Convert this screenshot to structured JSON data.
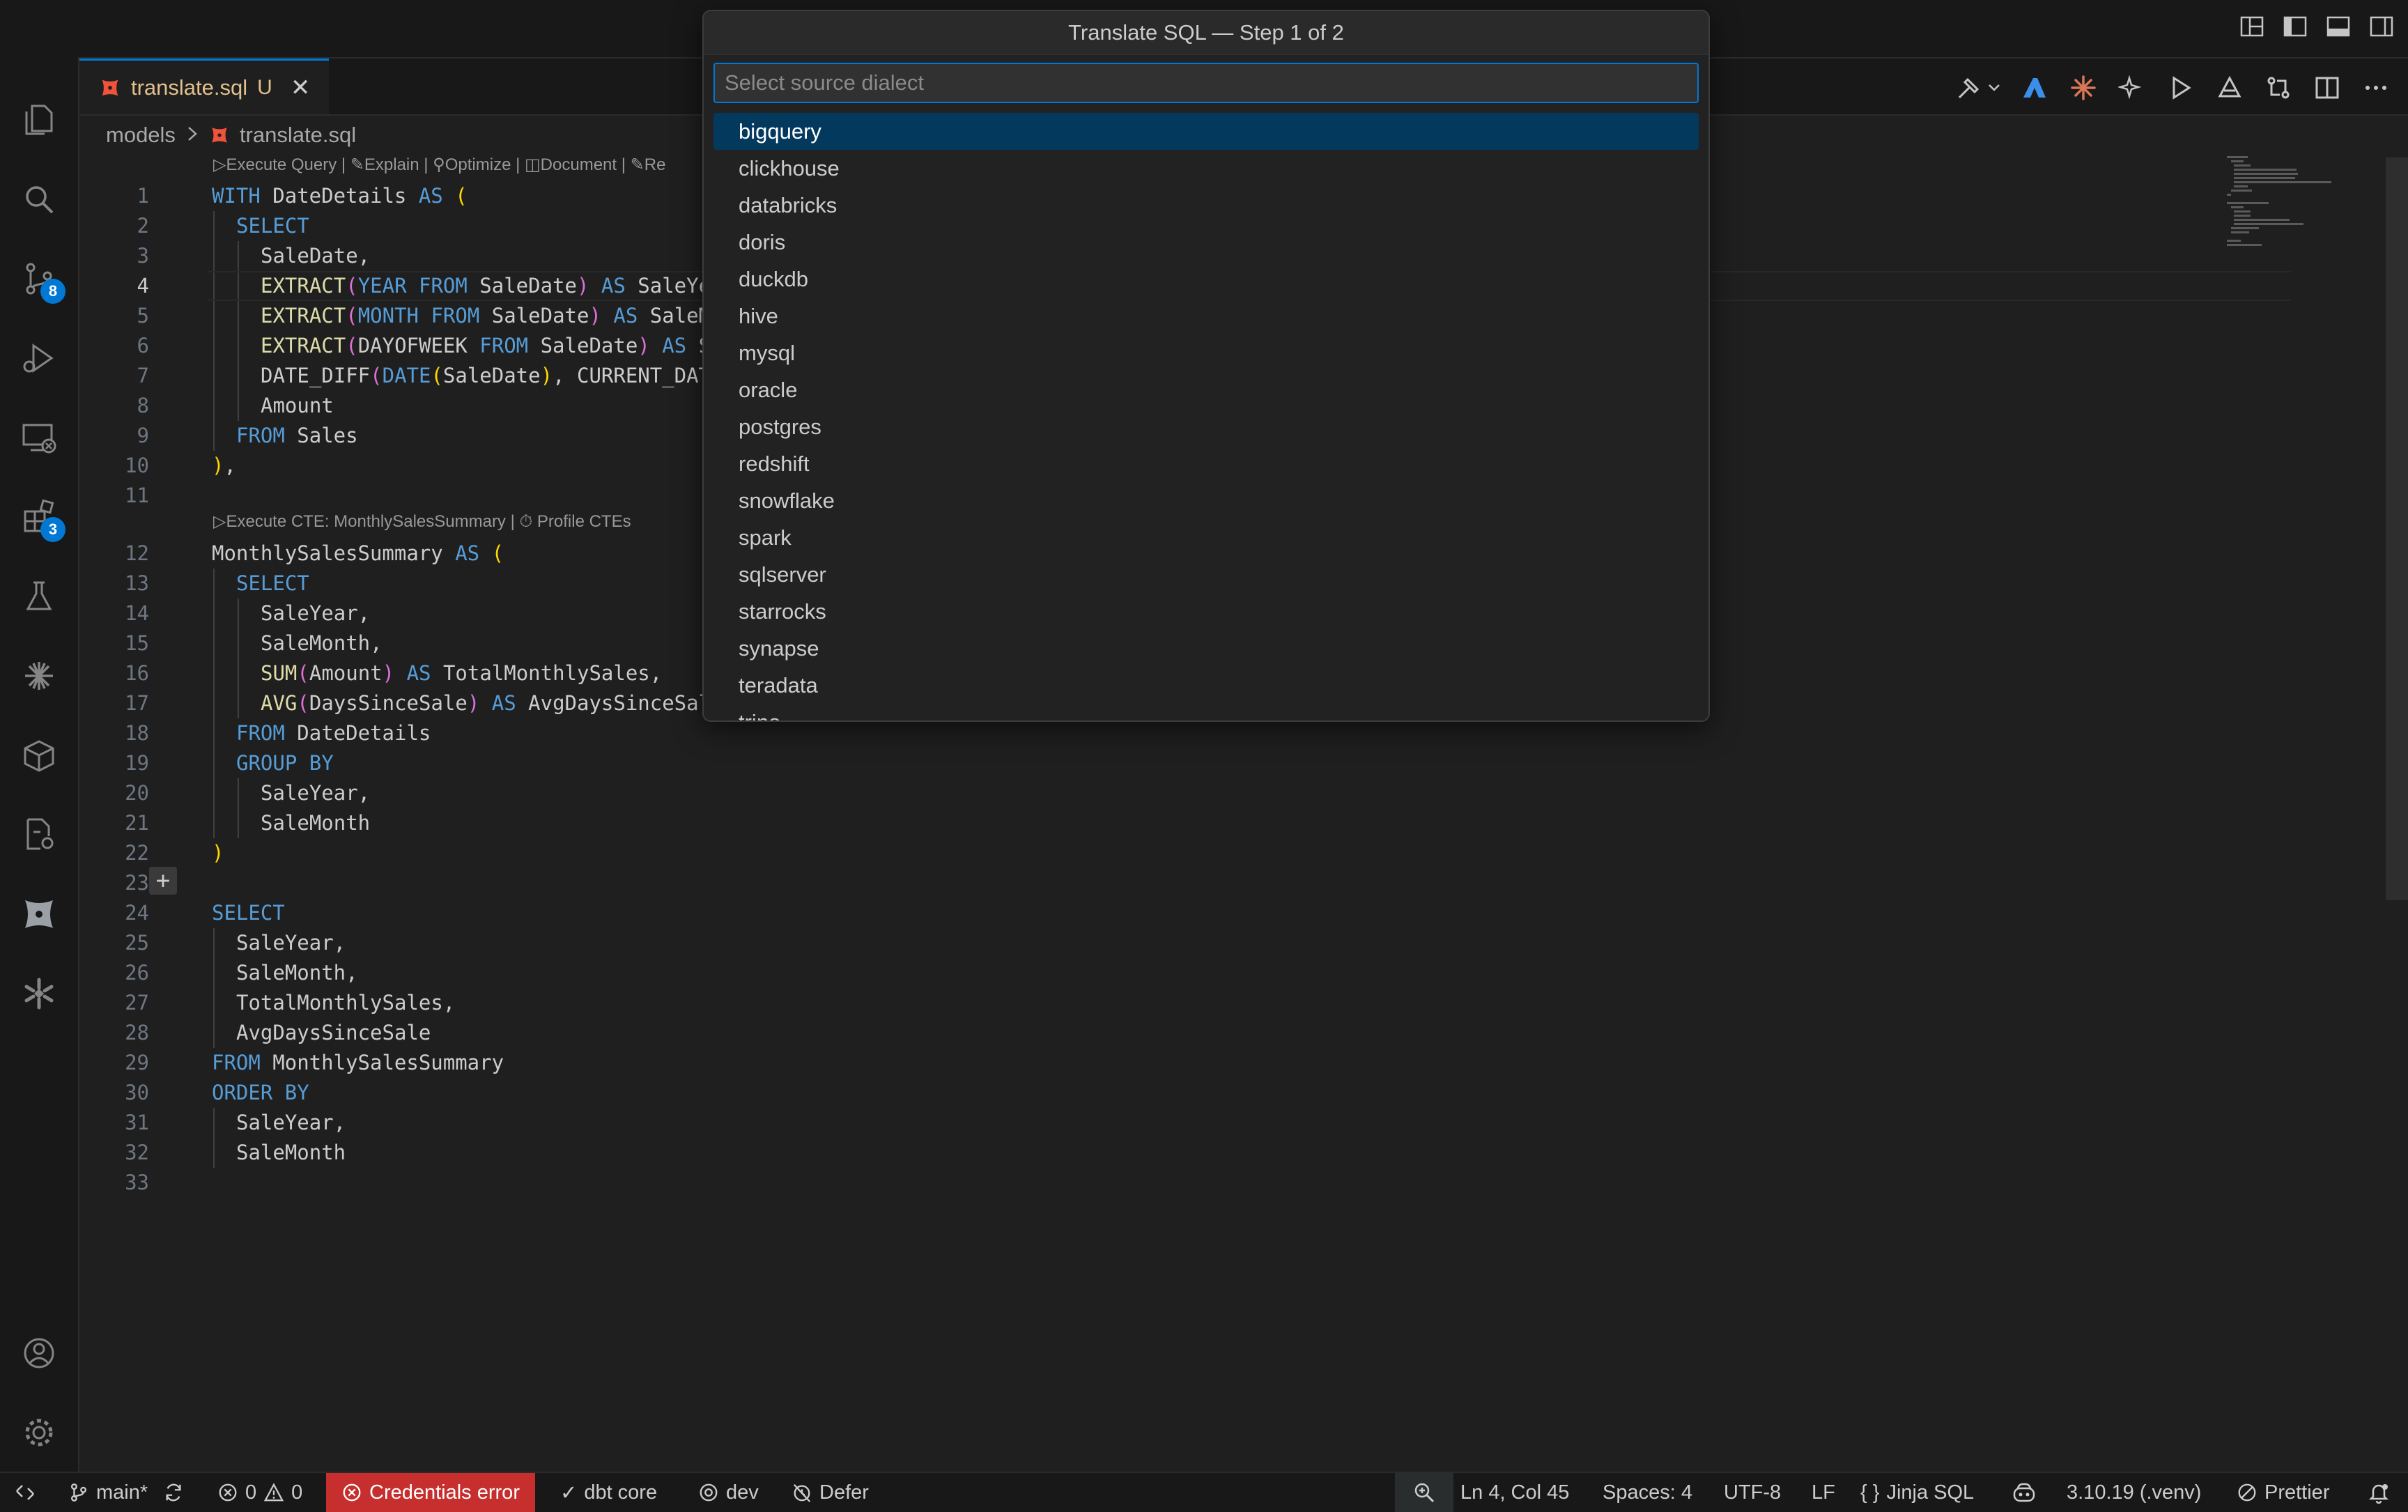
{
  "titlebar": {
    "layout_icons": [
      "customize-layout-icon",
      "toggle-primary-sidebar-icon",
      "toggle-panel-icon",
      "toggle-secondary-sidebar-icon"
    ]
  },
  "activity_bar": {
    "items": [
      {
        "icon": "explorer-icon"
      },
      {
        "icon": "search-icon"
      },
      {
        "icon": "source-control-icon",
        "badge": "8"
      },
      {
        "icon": "run-debug-icon"
      },
      {
        "icon": "remote-explorer-icon"
      },
      {
        "icon": "extensions-icon",
        "badge": "3"
      },
      {
        "icon": "testing-icon"
      },
      {
        "icon": "asterisk-icon"
      },
      {
        "icon": "package-icon"
      },
      {
        "icon": "settings-sync-icon"
      },
      {
        "icon": "dbt-icon"
      },
      {
        "icon": "snowflake-icon"
      }
    ],
    "bottom": [
      "accounts-icon",
      "manage-gear-icon"
    ]
  },
  "tab": {
    "name": "translate.sql",
    "status": "U"
  },
  "breadcrumb": {
    "folder": "models",
    "file": "translate.sql"
  },
  "codelens": {
    "top": "▷Execute Query | ✎Explain | ⚲Optimize | ◫Document | ✎Re",
    "cte": "▷Execute CTE: MonthlySalesSummary | ⏱ Profile CTEs"
  },
  "editor": {
    "active_line": 4,
    "lines": [
      {
        "n": "1",
        "indent": 0,
        "tokens": [
          [
            "kw",
            "WITH"
          ],
          [
            "",
            " DateDetails "
          ],
          [
            "kw",
            "AS"
          ],
          [
            "",
            " "
          ],
          [
            "paren",
            "("
          ]
        ]
      },
      {
        "n": "2",
        "indent": 1,
        "tokens": [
          [
            "kw",
            "SELECT"
          ]
        ]
      },
      {
        "n": "3",
        "indent": 2,
        "tokens": [
          [
            "",
            "SaleDate,"
          ]
        ]
      },
      {
        "n": "4",
        "indent": 2,
        "tokens": [
          [
            "fn",
            "EXTRACT"
          ],
          [
            "paren2",
            "("
          ],
          [
            "kw",
            "YEAR"
          ],
          [
            "",
            " "
          ],
          [
            "kw",
            "FROM"
          ],
          [
            "",
            " SaleDate"
          ],
          [
            "paren2",
            ")"
          ],
          [
            "",
            " "
          ],
          [
            "kw",
            "AS"
          ],
          [
            "",
            " SaleYe"
          ]
        ]
      },
      {
        "n": "5",
        "indent": 2,
        "tokens": [
          [
            "fn",
            "EXTRACT"
          ],
          [
            "paren2",
            "("
          ],
          [
            "kw",
            "MONTH"
          ],
          [
            "",
            " "
          ],
          [
            "kw",
            "FROM"
          ],
          [
            "",
            " SaleDate"
          ],
          [
            "paren2",
            ")"
          ],
          [
            "",
            " "
          ],
          [
            "kw",
            "AS"
          ],
          [
            "",
            " SaleM"
          ]
        ]
      },
      {
        "n": "6",
        "indent": 2,
        "tokens": [
          [
            "fn",
            "EXTRACT"
          ],
          [
            "paren2",
            "("
          ],
          [
            "",
            "DAYOFWEEK "
          ],
          [
            "kw",
            "FROM"
          ],
          [
            "",
            " SaleDate"
          ],
          [
            "paren2",
            ")"
          ],
          [
            "",
            " "
          ],
          [
            "kw",
            "AS"
          ],
          [
            "",
            " S"
          ]
        ]
      },
      {
        "n": "7",
        "indent": 2,
        "tokens": [
          [
            "",
            "DATE_DIFF"
          ],
          [
            "paren2",
            "("
          ],
          [
            "kw",
            "DATE"
          ],
          [
            "paren",
            "("
          ],
          [
            "",
            "SaleDate"
          ],
          [
            "paren",
            ")"
          ],
          [
            "",
            ", CURRENT_DAT"
          ]
        ]
      },
      {
        "n": "8",
        "indent": 2,
        "tokens": [
          [
            "",
            "Amount"
          ]
        ]
      },
      {
        "n": "9",
        "indent": 1,
        "tokens": [
          [
            "kw",
            "FROM"
          ],
          [
            "",
            " Sales"
          ]
        ]
      },
      {
        "n": "10",
        "indent": 0,
        "tokens": [
          [
            "paren",
            ")"
          ],
          [
            "",
            ","
          ]
        ]
      },
      {
        "n": "11",
        "indent": 0,
        "tokens": []
      },
      {
        "n": "12",
        "indent": 0,
        "tokens": [
          [
            "",
            "MonthlySalesSummary "
          ],
          [
            "kw",
            "AS"
          ],
          [
            "",
            " "
          ],
          [
            "paren",
            "("
          ]
        ]
      },
      {
        "n": "13",
        "indent": 1,
        "tokens": [
          [
            "kw",
            "SELECT"
          ]
        ]
      },
      {
        "n": "14",
        "indent": 2,
        "tokens": [
          [
            "",
            "SaleYear,"
          ]
        ]
      },
      {
        "n": "15",
        "indent": 2,
        "tokens": [
          [
            "",
            "SaleMonth,"
          ]
        ]
      },
      {
        "n": "16",
        "indent": 2,
        "tokens": [
          [
            "fn",
            "SUM"
          ],
          [
            "paren2",
            "("
          ],
          [
            "",
            "Amount"
          ],
          [
            "paren2",
            ")"
          ],
          [
            "",
            " "
          ],
          [
            "kw",
            "AS"
          ],
          [
            "",
            " TotalMonthlySales,"
          ]
        ]
      },
      {
        "n": "17",
        "indent": 2,
        "tokens": [
          [
            "fn",
            "AVG"
          ],
          [
            "paren2",
            "("
          ],
          [
            "",
            "DaysSinceSale"
          ],
          [
            "paren2",
            ")"
          ],
          [
            "",
            " "
          ],
          [
            "kw",
            "AS"
          ],
          [
            "",
            " AvgDaysSinceSal"
          ]
        ]
      },
      {
        "n": "18",
        "indent": 1,
        "tokens": [
          [
            "kw",
            "FROM"
          ],
          [
            "",
            " DateDetails"
          ]
        ]
      },
      {
        "n": "19",
        "indent": 1,
        "tokens": [
          [
            "kw",
            "GROUP BY"
          ]
        ]
      },
      {
        "n": "20",
        "indent": 2,
        "tokens": [
          [
            "",
            "SaleYear,"
          ]
        ]
      },
      {
        "n": "21",
        "indent": 2,
        "tokens": [
          [
            "",
            "SaleMonth"
          ]
        ]
      },
      {
        "n": "22",
        "indent": 0,
        "tokens": [
          [
            "paren",
            ")"
          ]
        ]
      },
      {
        "n": "23",
        "indent": 0,
        "tokens": []
      },
      {
        "n": "24",
        "indent": 0,
        "tokens": [
          [
            "kw",
            "SELECT"
          ]
        ]
      },
      {
        "n": "25",
        "indent": 1,
        "tokens": [
          [
            "",
            "SaleYear,"
          ]
        ]
      },
      {
        "n": "26",
        "indent": 1,
        "tokens": [
          [
            "",
            "SaleMonth,"
          ]
        ]
      },
      {
        "n": "27",
        "indent": 1,
        "tokens": [
          [
            "",
            "TotalMonthlySales,"
          ]
        ]
      },
      {
        "n": "28",
        "indent": 1,
        "tokens": [
          [
            "",
            "AvgDaysSinceSale"
          ]
        ]
      },
      {
        "n": "29",
        "indent": 0,
        "tokens": [
          [
            "kw",
            "FROM"
          ],
          [
            "",
            " MonthlySalesSummary"
          ]
        ]
      },
      {
        "n": "30",
        "indent": 0,
        "tokens": [
          [
            "kw",
            "ORDER BY"
          ]
        ]
      },
      {
        "n": "31",
        "indent": 1,
        "tokens": [
          [
            "",
            "SaleYear,"
          ]
        ]
      },
      {
        "n": "32",
        "indent": 1,
        "tokens": [
          [
            "",
            "SaleMonth"
          ]
        ]
      },
      {
        "n": "33",
        "indent": 0,
        "tokens": []
      }
    ]
  },
  "quickpick": {
    "title": "Translate SQL — Step 1 of 2",
    "placeholder": "Select source dialect",
    "value": "",
    "selected": "bigquery",
    "items": [
      "bigquery",
      "clickhouse",
      "databricks",
      "doris",
      "duckdb",
      "hive",
      "mysql",
      "oracle",
      "postgres",
      "redshift",
      "snowflake",
      "spark",
      "sqlserver",
      "starrocks",
      "synapse",
      "teradata",
      "trino"
    ]
  },
  "statusbar": {
    "branch": "main*",
    "errors": "0",
    "warnings": "0",
    "credentials": "Credentials error",
    "dbt": "dbt core",
    "target": "dev",
    "defer": "Defer",
    "position": "Ln 4, Col 45",
    "spaces": "Spaces: 4",
    "encoding": "UTF-8",
    "eol": "LF",
    "language": "Jinja SQL",
    "python": "3.10.19 (.venv)",
    "formatter": "Prettier"
  },
  "colors": {
    "accent": "#0078d4",
    "error_bg": "#c72e2e",
    "keyword": "#569cd6",
    "function": "#dcdcaa",
    "paren": "#ffd700",
    "modified": "#e2c08d",
    "dbt_orange": "#f0533c"
  }
}
